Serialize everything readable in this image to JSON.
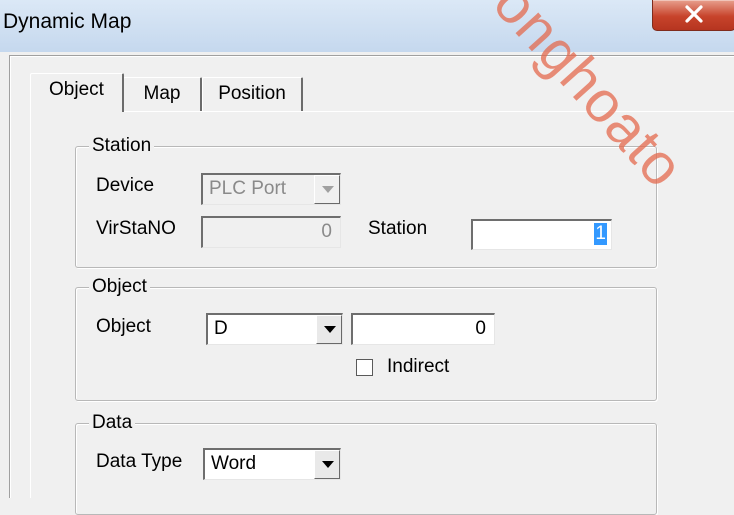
{
  "window": {
    "title": "Dynamic Map"
  },
  "tabs": [
    {
      "label": "Object",
      "active": true
    },
    {
      "label": "Map",
      "active": false
    },
    {
      "label": "Position",
      "active": false
    }
  ],
  "station": {
    "legend": "Station",
    "device_label": "Device",
    "device_value": "PLC Port",
    "virstano_label": "VirStaNO",
    "virstano_value": "0",
    "station_label": "Station",
    "station_value": "1"
  },
  "object": {
    "legend": "Object",
    "object_label": "Object",
    "object_type": "D",
    "object_address": "0",
    "indirect_label": "Indirect",
    "indirect_checked": false
  },
  "data": {
    "legend": "Data",
    "data_type_label": "Data Type",
    "data_type_value": "Word"
  },
  "watermark": {
    "text": "onghoato"
  },
  "colors": {
    "close_button": "#c7432b",
    "watermark": "#e46a4e",
    "selection": "#3399ff"
  }
}
